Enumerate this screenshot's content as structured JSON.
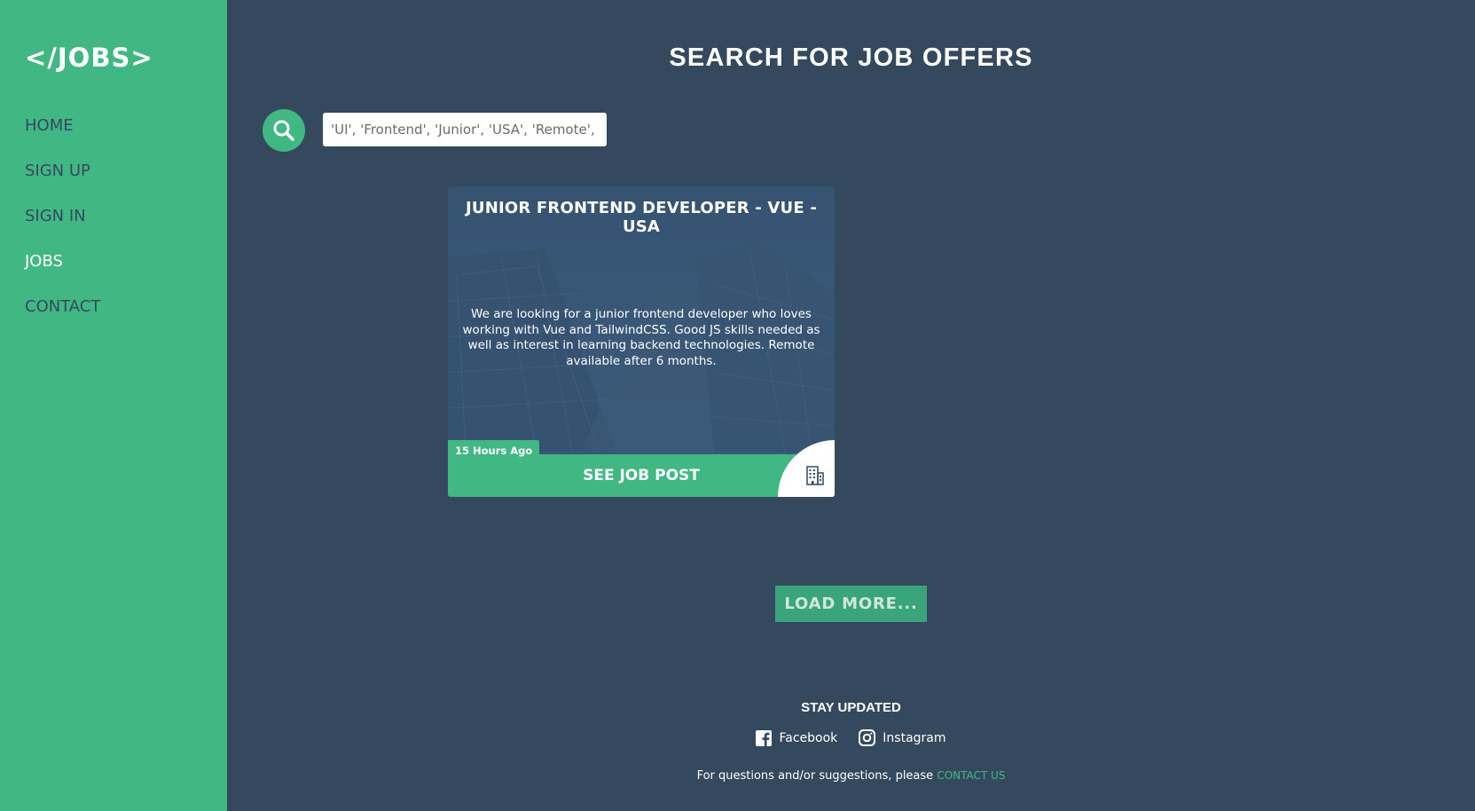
{
  "brand": {
    "logo": "</JOBS>",
    "accent": "#41b883",
    "dark": "#35495e"
  },
  "nav": {
    "items": [
      {
        "label": "HOME"
      },
      {
        "label": "SIGN UP"
      },
      {
        "label": "SIGN IN"
      },
      {
        "label": "JOBS",
        "active": true
      },
      {
        "label": "CONTACT"
      }
    ]
  },
  "main": {
    "title": "SEARCH FOR JOB OFFERS",
    "search": {
      "placeholder": "'UI', 'Frontend', 'Junior', 'USA', 'Remote', ...",
      "icon": "search-icon"
    }
  },
  "job": {
    "title": "JUNIOR FRONTEND DEVELOPER - VUE - USA",
    "description": "We are looking for a junior frontend developer who loves working with Vue and TailwindCSS. Good JS skills needed as well as interest in learning backend technologies. Remote available after 6 months.",
    "posted": "15 Hours Ago",
    "cta": "SEE JOB POST",
    "icon": "building-icon"
  },
  "load_more": "LOAD MORE...",
  "footer": {
    "heading": "STAY UPDATED",
    "facebook": "Facebook",
    "instagram": "Instagram",
    "note": "For questions and/or suggestions, please",
    "contact_link": "CONTACT US"
  }
}
